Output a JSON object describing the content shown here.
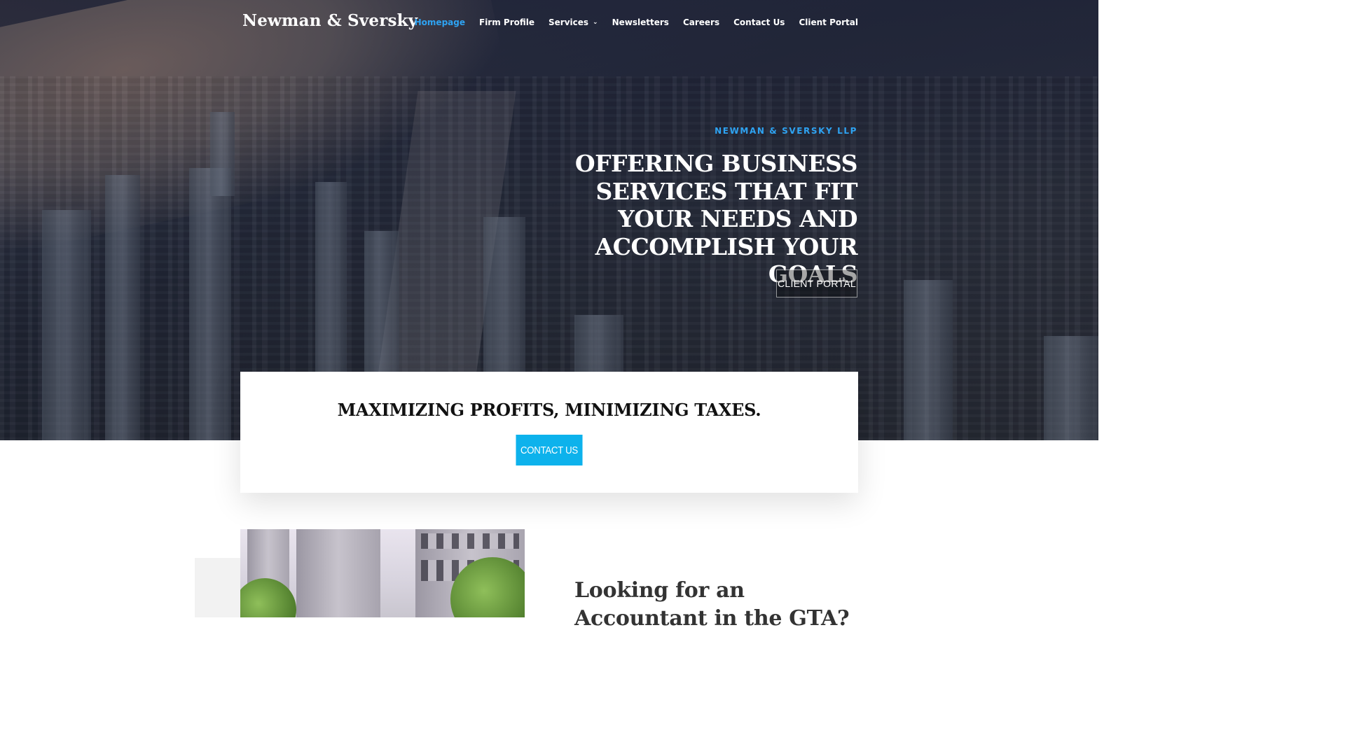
{
  "brand": {
    "logo_text": "Newman & Sversky"
  },
  "nav": {
    "items": [
      {
        "label": "Homepage",
        "active": true
      },
      {
        "label": "Firm Profile",
        "active": false
      },
      {
        "label": "Services",
        "active": false,
        "has_dropdown": true
      },
      {
        "label": "Newsletters",
        "active": false
      },
      {
        "label": "Careers",
        "active": false
      },
      {
        "label": "Contact Us",
        "active": false
      },
      {
        "label": "Client Portal",
        "active": false
      }
    ],
    "dropdown_icon": "chevron-down-icon"
  },
  "hero": {
    "eyebrow": "NEWMAN & SVERSKY LLP",
    "headline": "OFFERING BUSINESS SERVICES THAT FIT YOUR NEEDS AND ACCOMPLISH YOUR GOALS",
    "cta_label": "CLIENT PORTAL"
  },
  "card": {
    "title": "MAXIMIZING PROFITS, MINIMIZING TAXES.",
    "cta_label": "CONTACT US"
  },
  "intro": {
    "title": "Looking for an Accountant in the GTA?"
  },
  "colors": {
    "accent": "#2ea3f2",
    "button_blue": "#0db2ec",
    "heading_dark": "#111111",
    "body_heading": "#333333"
  }
}
